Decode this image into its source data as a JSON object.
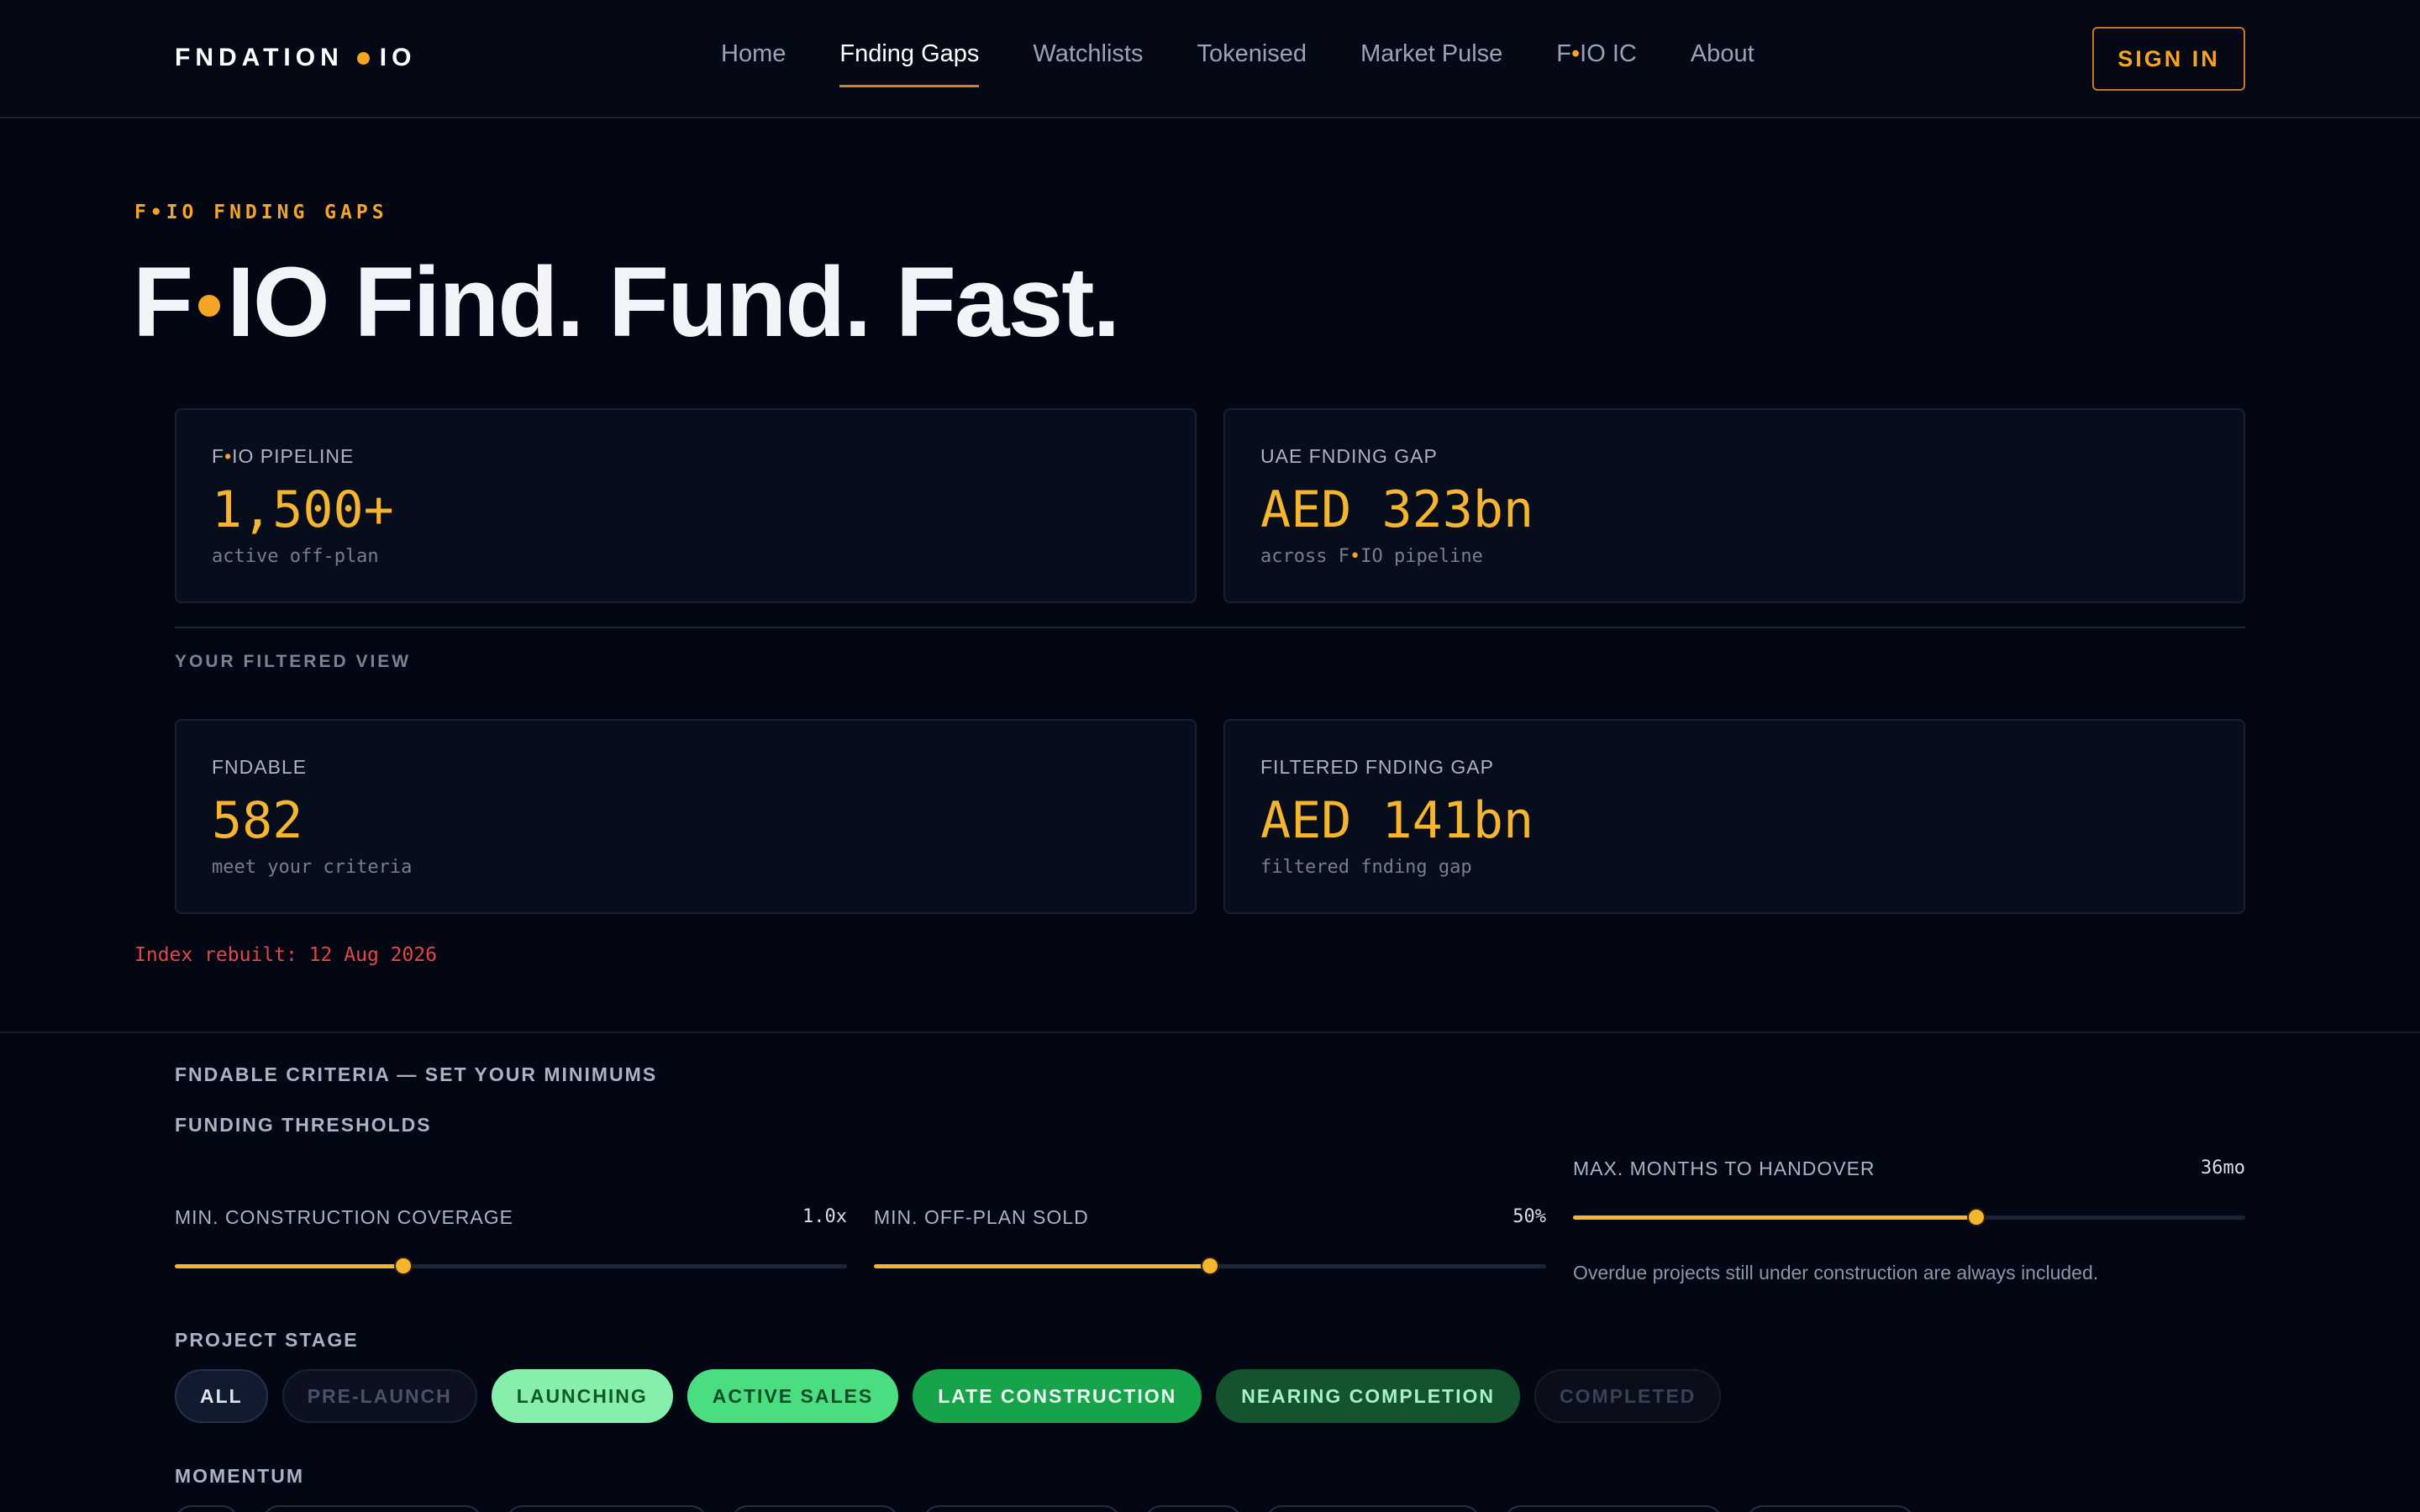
{
  "nav": {
    "logo_left": "FNDATION",
    "logo_right": "IO",
    "links": [
      "Home",
      "Fnding Gaps",
      "Watchlists",
      "Tokenised",
      "Market Pulse",
      "F",
      "About"
    ],
    "link_ic_suffix": "IO IC",
    "active_index": 1,
    "sign_in": "SIGN IN"
  },
  "hero": {
    "eyebrow": "F•IO FNDING GAPS",
    "title_prefix": "F",
    "title_rest": "IO Find. Fund. Fast."
  },
  "pipeline": {
    "label_prefix": "F",
    "label_rest": "IO PIPELINE",
    "value": "1,500+",
    "sub": "active off-plan"
  },
  "uae_gap": {
    "label": "UAE FNDING GAP",
    "value": "AED 323bn",
    "sub_prefix": "across F",
    "sub_rest": "IO pipeline"
  },
  "filtered_view_label": "YOUR FILTERED VIEW",
  "fndable": {
    "label": "FNDABLE",
    "value": "582",
    "sub": "meet your criteria"
  },
  "filtered_gap": {
    "label": "FILTERED FNDING GAP",
    "value": "AED 141bn",
    "sub": "filtered fnding gap"
  },
  "index_note": "Index rebuilt: 12 Aug 2026",
  "criteria": {
    "title": "FNDABLE CRITERIA — SET YOUR MINIMUMS",
    "thresholds_title": "FUNDING THRESHOLDS",
    "sliders": [
      {
        "label": "MIN. CONSTRUCTION COVERAGE",
        "value": "1.0x",
        "fraction": 0.34
      },
      {
        "label": "MIN. OFF-PLAN SOLD",
        "value": "50%",
        "fraction": 0.5
      },
      {
        "label": "MAX. MONTHS TO HANDOVER",
        "value": "36mo",
        "fraction": 0.6
      }
    ],
    "handover_note": "Overdue projects still under construction are always included.",
    "stage_title": "PROJECT STAGE",
    "stages": [
      "ALL",
      "PRE-LAUNCH",
      "LAUNCHING",
      "ACTIVE SALES",
      "LATE CONSTRUCTION",
      "NEARING COMPLETION",
      "COMPLETED"
    ],
    "momentum_title": "MOMENTUM"
  },
  "colors": {
    "accent": "#f5a524",
    "value": "#f5b52e",
    "error": "#e04848",
    "background": "#030714"
  }
}
